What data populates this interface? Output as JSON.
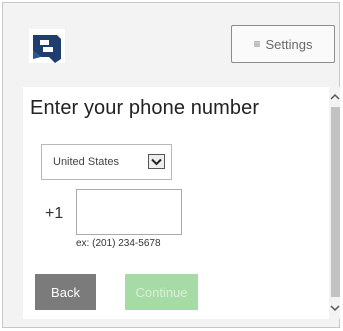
{
  "header": {
    "logo_icon": "brand-logo-icon",
    "settings_label": "Settings",
    "settings_icon": "hamburger-icon"
  },
  "form": {
    "title": "Enter your phone number",
    "country": {
      "selected": "United States",
      "icon": "chevron-down-icon"
    },
    "country_code": "+1",
    "phone": {
      "value": "",
      "example": "ex: (201) 234-5678"
    },
    "back_label": "Back",
    "continue_label": "Continue"
  },
  "scrollbar": {
    "up_icon": "chevron-up-icon",
    "down_icon": "chevron-down-icon"
  },
  "colors": {
    "back_button": "#7b7b7b",
    "continue_button_disabled": "#a6dba6",
    "logo": "#1f3e6f"
  }
}
